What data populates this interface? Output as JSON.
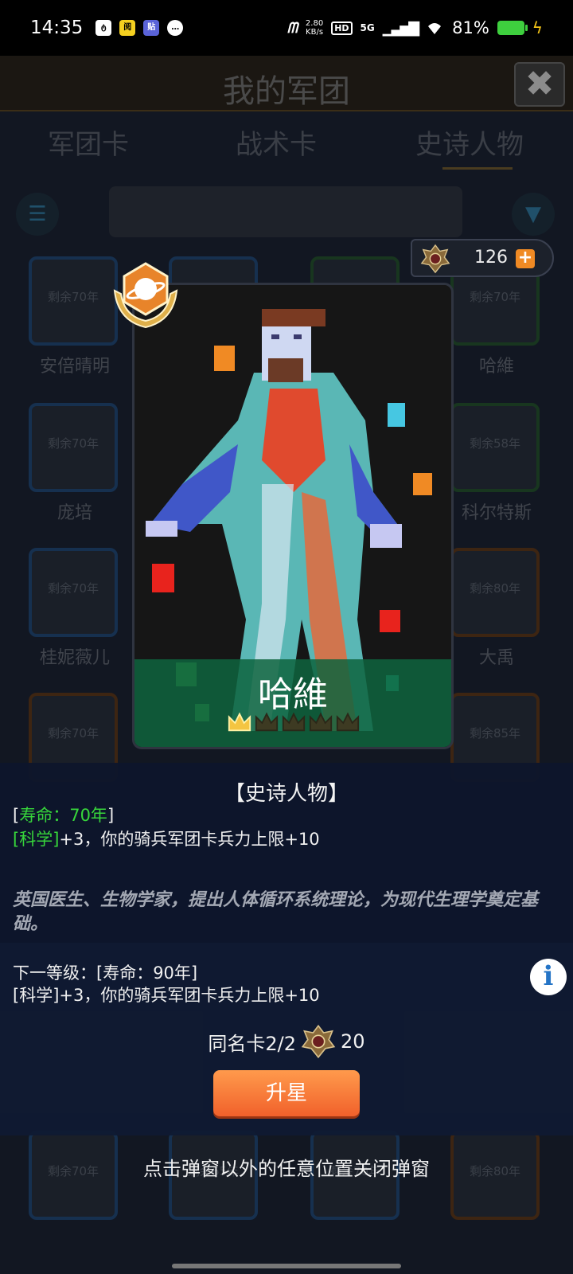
{
  "status_bar": {
    "time": "14:35",
    "speed_value": "2.80",
    "speed_unit": "KB/s",
    "hd": "HD",
    "network": "5G",
    "battery": "81%"
  },
  "header": {
    "title": "我的军团",
    "close_glyph": "✖"
  },
  "tabs": [
    "军团卡",
    "战术卡",
    "史诗人物"
  ],
  "tokens": {
    "count": "126",
    "plus": "+"
  },
  "cards": [
    {
      "years": "剩余70年",
      "name": "安倍晴明",
      "color": "blue"
    },
    {
      "years": "",
      "name": "",
      "color": "blue"
    },
    {
      "years": "",
      "name": "",
      "color": "green"
    },
    {
      "years": "剩余70年",
      "name": "哈維",
      "color": "green"
    },
    {
      "years": "剩余70年",
      "name": "庞培",
      "color": "blue"
    },
    {
      "years": "剩余58年",
      "name": "科尔特斯",
      "color": "green"
    },
    {
      "years": "剩余70年",
      "name": "桂妮薇儿",
      "color": "blue"
    },
    {
      "years": "剩余80年",
      "name": "大禹",
      "color": "orange"
    },
    {
      "years": "剩余70年",
      "name": "",
      "color": "orange"
    },
    {
      "years": "剩余85年",
      "name": "",
      "color": "orange"
    },
    {
      "years": "剩余70年",
      "name": "",
      "color": "blue"
    },
    {
      "years": "剩余65年",
      "name": "",
      "color": "blue"
    },
    {
      "years": "剩余70年",
      "name": "",
      "color": "blue"
    },
    {
      "years": "剩余80年",
      "name": "",
      "color": "orange"
    }
  ],
  "popup": {
    "card_name": "哈維",
    "crowns_filled": 1,
    "crowns_total": 5,
    "category": "【史诗人物】",
    "lifespan_open": "[",
    "lifespan": "寿命：70年",
    "lifespan_close": "]",
    "effect_tag": "[科学]",
    "effect_text": "+3，你的骑兵军团卡兵力上限+10",
    "description": "英国医生、生物学家，提出人体循环系统理论，为现代生理学奠定基础。",
    "next_level": "下一等级：[寿命：90年]",
    "next_effect": "[科学]+3，你的骑兵军团卡兵力上限+10",
    "same_card": "同名卡2/2",
    "cost": "20",
    "upgrade_button": "升星",
    "close_hint": "点击弹窗以外的任意位置关闭弹窗"
  },
  "colors": {
    "accent_orange": "#f1612b",
    "lifespan_green": "#37d63b",
    "card_band_green": "#0e643e",
    "crown_gold": "#f4c542"
  }
}
